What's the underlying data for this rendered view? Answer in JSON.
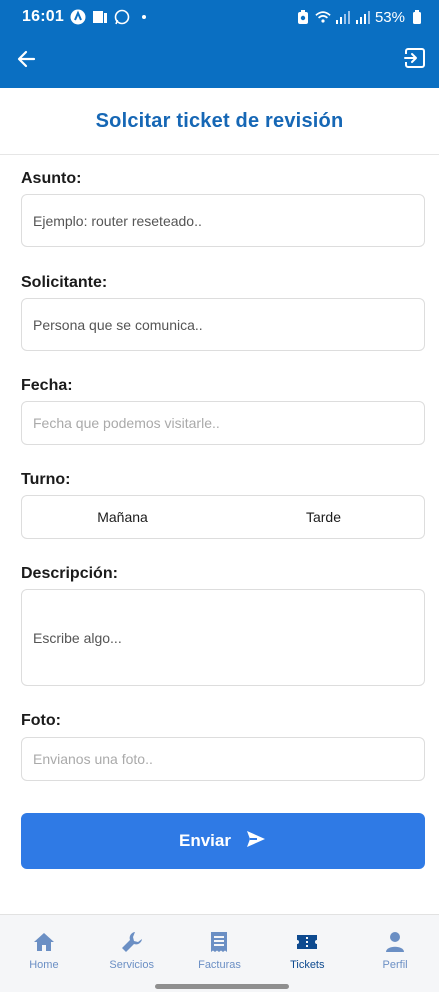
{
  "status_bar": {
    "time": "16:01",
    "battery": "53%"
  },
  "page": {
    "title": "Solcitar ticket de revisión"
  },
  "form": {
    "asunto": {
      "label": "Asunto:",
      "placeholder": "Ejemplo: router reseteado.."
    },
    "solicitante": {
      "label": "Solicitante:",
      "placeholder": "Persona que se comunica.."
    },
    "fecha": {
      "label": "Fecha:",
      "placeholder": "Fecha que podemos visitarle.."
    },
    "turno": {
      "label": "Turno:",
      "options": [
        "Mañana",
        "Tarde"
      ]
    },
    "descripcion": {
      "label": "Descripción:",
      "placeholder": "Escribe algo..."
    },
    "foto": {
      "label": "Foto:",
      "placeholder": "Envianos una foto.."
    },
    "submit_label": "Enviar"
  },
  "bottom_nav": {
    "items": [
      {
        "label": "Home",
        "icon": "home-icon",
        "active": false
      },
      {
        "label": "Servicios",
        "icon": "wrench-icon",
        "active": false
      },
      {
        "label": "Facturas",
        "icon": "receipt-icon",
        "active": false
      },
      {
        "label": "Tickets",
        "icon": "ticket-icon",
        "active": true
      },
      {
        "label": "Perfil",
        "icon": "person-icon",
        "active": false
      }
    ]
  },
  "colors": {
    "primary": "#0a6fc2",
    "button": "#2f7ae5",
    "title": "#1667b5",
    "nav_active": "#0e4a8f",
    "nav_inactive": "#6b8fc4"
  }
}
